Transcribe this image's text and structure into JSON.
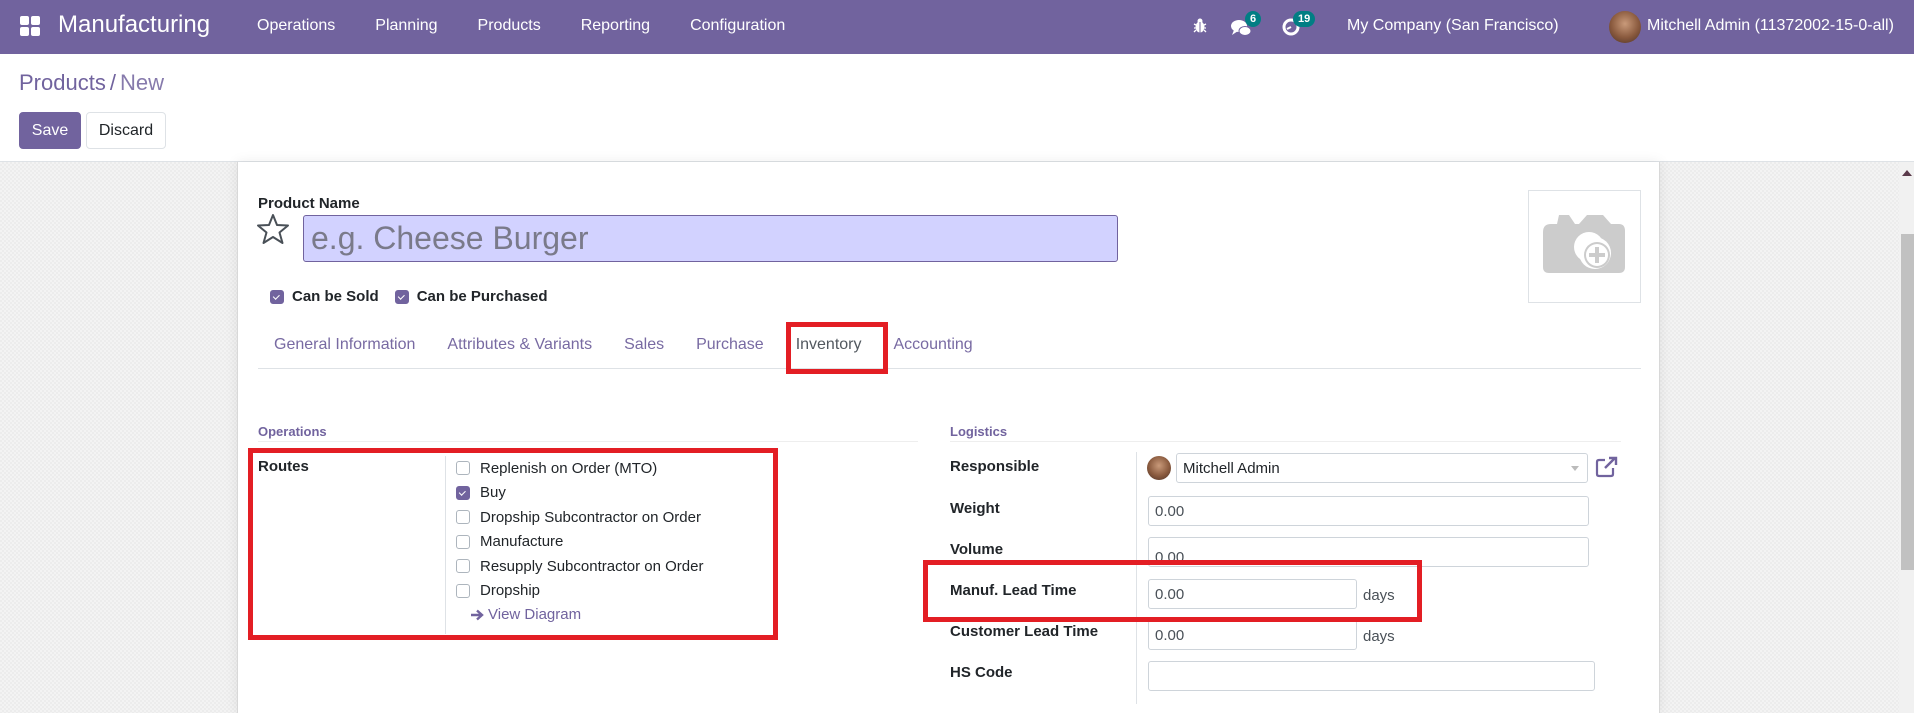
{
  "navbar": {
    "app_name": "Manufacturing",
    "menu": [
      "Operations",
      "Planning",
      "Products",
      "Reporting",
      "Configuration"
    ],
    "messages_count": "6",
    "activities_count": "19",
    "company": "My Company (San Francisco)",
    "user": "Mitchell Admin (11372002-15-0-all)",
    "icons": {
      "apps": "apps-grid-icon",
      "debug": "bug-icon",
      "messages": "chat-icon",
      "activities": "clock-icon"
    }
  },
  "control_panel": {
    "breadcrumb": {
      "parent": "Products",
      "separator": "/",
      "current": "New"
    },
    "save_label": "Save",
    "discard_label": "Discard"
  },
  "form": {
    "product_name_label": "Product Name",
    "product_name_value": "",
    "product_name_placeholder": "e.g. Cheese Burger",
    "can_be_sold": {
      "label": "Can be Sold",
      "checked": true
    },
    "can_be_purchased": {
      "label": "Can be Purchased",
      "checked": true
    },
    "tabs": [
      {
        "label": "General Information",
        "active": false
      },
      {
        "label": "Attributes & Variants",
        "active": false
      },
      {
        "label": "Sales",
        "active": false
      },
      {
        "label": "Purchase",
        "active": false
      },
      {
        "label": "Inventory",
        "active": true
      },
      {
        "label": "Accounting",
        "active": false
      }
    ],
    "operations": {
      "title": "Operations",
      "routes_label": "Routes",
      "routes": [
        {
          "label": "Replenish on Order (MTO)",
          "checked": false
        },
        {
          "label": "Buy",
          "checked": true
        },
        {
          "label": "Dropship Subcontractor on Order",
          "checked": false
        },
        {
          "label": "Manufacture",
          "checked": false
        },
        {
          "label": "Resupply Subcontractor on Order",
          "checked": false
        },
        {
          "label": "Dropship",
          "checked": false
        }
      ],
      "view_diagram": "View Diagram"
    },
    "logistics": {
      "title": "Logistics",
      "responsible_label": "Responsible",
      "responsible_value": "Mitchell Admin",
      "weight_label": "Weight",
      "weight_value": "0.00",
      "volume_label": "Volume",
      "volume_value": "0.00",
      "manuf_lead_label": "Manuf. Lead Time",
      "manuf_lead_value": "0.00",
      "customer_lead_label": "Customer Lead Time",
      "customer_lead_value": "0.00",
      "days_unit": "days",
      "hs_code_label": "HS Code",
      "hs_code_value": ""
    }
  },
  "annotations": {
    "highlight_color": "#e31e24"
  },
  "colors": {
    "brand": "#71639e",
    "badge": "#017e84",
    "name_input_bg": "#d2d2ff"
  }
}
